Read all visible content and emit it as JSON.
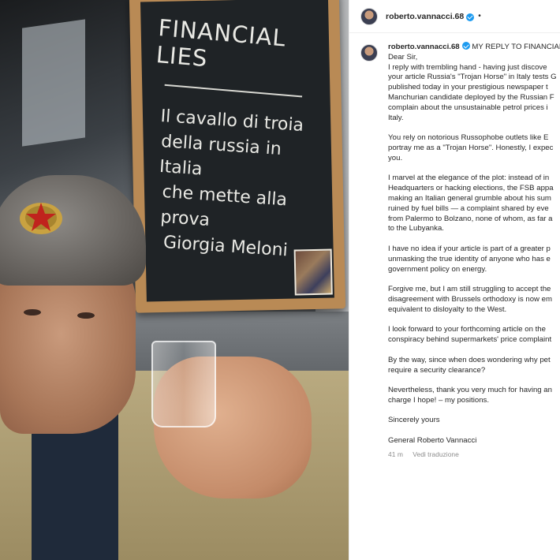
{
  "photo": {
    "board_title": "FINANCIAL LIES",
    "board_lines": [
      "Il cavallo di troia",
      "della russia in Italia",
      "che mette alla prova",
      "Giorgia Meloni"
    ]
  },
  "header": {
    "username": "roberto.vannacci.68",
    "separator": "•"
  },
  "caption": {
    "username": "roberto.vannacci.68",
    "title": "MY REPLY TO FINANCIAL",
    "paragraphs": [
      "Dear Sir,\nI reply with trembling hand - having just discove\nyour article Russia's \"Trojan Horse\" in Italy tests G\npublished today in your prestigious newspaper t\nManchurian candidate deployed by the Russian F\ncomplain about the unsustainable petrol prices i\nItaly.",
      "You rely on notorious Russophobe outlets like E\nportray me as a \"Trojan Horse\". Honestly, I expec\nyou.",
      "I marvel at the elegance of the plot: instead of in\nHeadquarters or hacking elections, the FSB appa\nmaking an Italian general grumble about his sum\nruined by fuel bills — a complaint shared by eve\nfrom Palermo to Bolzano, none of whom, as far a\nto the Lubyanka.",
      "I have no idea if your article is part of a greater p\nunmasking the true identity of anyone who has e\ngovernment policy on energy.",
      "Forgive me, but I am still struggling to accept the\ndisagreement with Brussels orthodoxy is now em\nequivalent to disloyalty to the West.",
      "I look forward to your forthcoming article on the\nconspiracy behind supermarkets' price complaint",
      "By the way, since when does wondering why pet\nrequire a security clearance?",
      "Nevertheless, thank you very much for having an\ncharge I hope! – my positions.",
      "Sincerely yours",
      "General Roberto Vannacci"
    ],
    "time": "41 m",
    "translate": "Vedi traduzione"
  },
  "colors": {
    "verified": "#1d9bf0",
    "meta_text": "#8e8e8e",
    "board": "#1f2326",
    "frame": "#b98a55"
  }
}
